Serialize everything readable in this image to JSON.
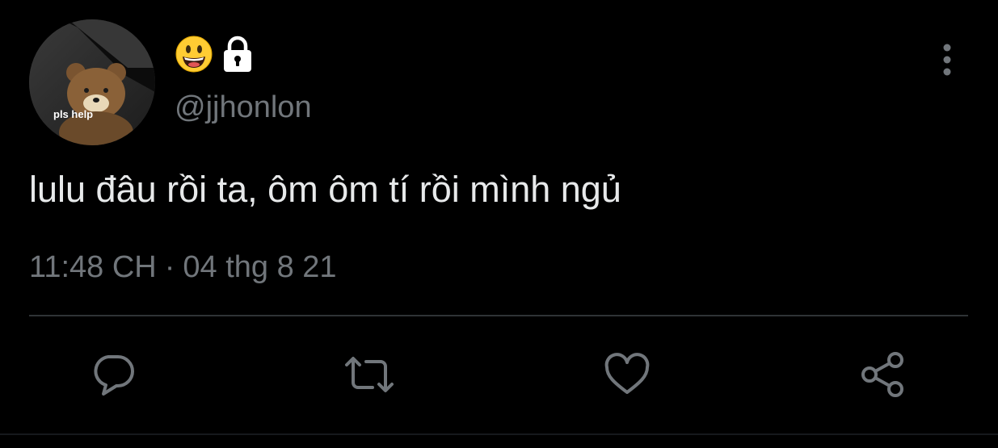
{
  "author": {
    "emoji_icon": "grinning-face-emoji",
    "protected_icon": "lock-icon",
    "handle": "@jjhonlon",
    "avatar": {
      "caption": "pls help",
      "description_icon": "teddy-bear"
    }
  },
  "tweet": {
    "text": "lulu đâu rồi ta, ôm ôm tí rồi mình ngủ",
    "time": "11:48 CH",
    "separator": "·",
    "date": "04 thg 8 21"
  },
  "actions": {
    "reply_icon": "reply-icon",
    "retweet_icon": "retweet-icon",
    "like_icon": "heart-icon",
    "share_icon": "share-icon",
    "more_icon": "more-vertical-icon"
  },
  "colors": {
    "background": "#000000",
    "text": "#e7e9ea",
    "secondary": "#71767b",
    "icon": "#71767b",
    "divider": "#2f3336"
  }
}
